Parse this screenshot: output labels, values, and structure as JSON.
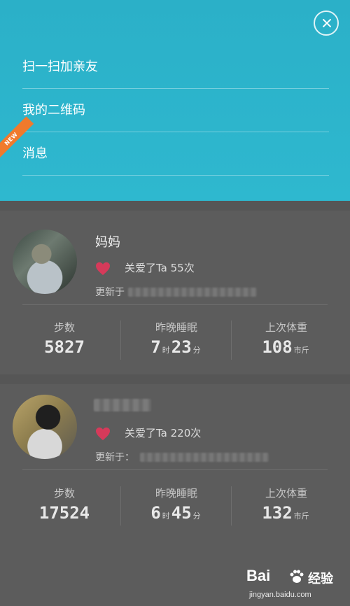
{
  "menu": {
    "items": [
      {
        "label": "扫一扫加亲友"
      },
      {
        "label": "我的二维码"
      },
      {
        "label": "消息",
        "badge": "NEW"
      }
    ]
  },
  "cards": [
    {
      "name": "妈妈",
      "care_text": "关爱了Ta 55次",
      "updated_label": "更新于",
      "stats": [
        {
          "label": "步数",
          "value": "5827"
        },
        {
          "label": "昨晚睡眠",
          "hours": "7",
          "hours_unit": "时",
          "minutes": "23",
          "minutes_unit": "分"
        },
        {
          "label": "上次体重",
          "value": "108",
          "unit": "市斤"
        }
      ]
    },
    {
      "name": "",
      "care_text": "关爱了Ta 220次",
      "updated_label": "更新于：",
      "stats": [
        {
          "label": "步数",
          "value": "17524"
        },
        {
          "label": "昨晚睡眠",
          "hours": "6",
          "hours_unit": "时",
          "minutes": "45",
          "minutes_unit": "分"
        },
        {
          "label": "上次体重",
          "value": "132",
          "unit": "市斤"
        }
      ]
    }
  ],
  "colors": {
    "accent": "#2eb8cf",
    "heart": "#d63a5a",
    "new_badge": "#f07a2c"
  },
  "icons": {
    "close": "close-icon",
    "heart": "heart-icon"
  },
  "watermark": {
    "brand": "Bai",
    "brand_cn": "经验",
    "url": "jingyan.baidu.com"
  }
}
